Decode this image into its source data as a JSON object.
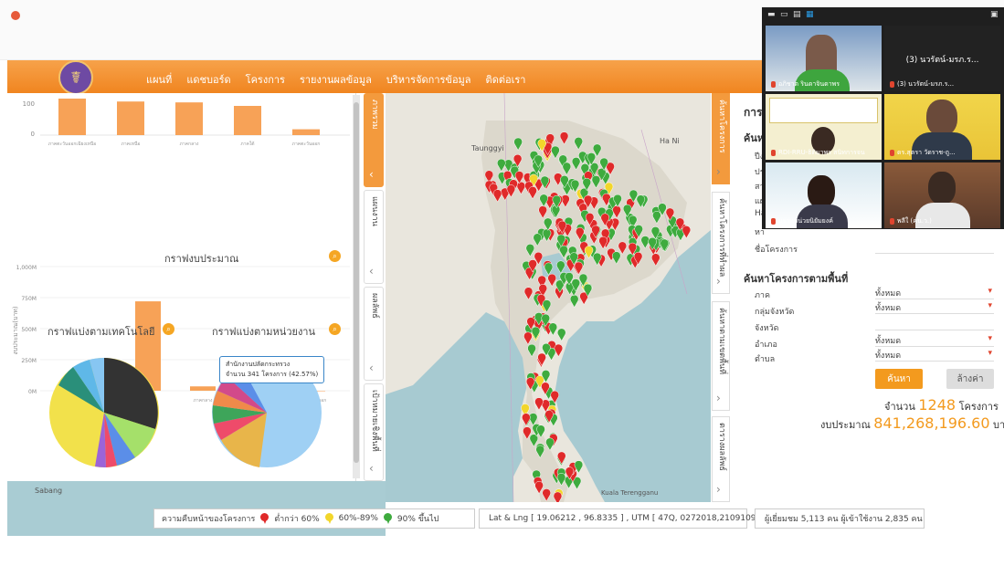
{
  "header": {
    "logo_glyph": "☤",
    "nav": [
      "แผนที่",
      "แดชบอร์ด",
      "โครงการ",
      "รายงานผลข้อมูล",
      "บริหารจัดการข้อมูล",
      "ติดต่อเรา"
    ]
  },
  "left_charts": {
    "top_bar": {
      "type": "bar",
      "yticks": [
        "100",
        "0"
      ],
      "categories": [
        "ภาคตะวันออกเฉียงเหนือ",
        "ภาคเหนือ",
        "ภาคกลาง",
        "ภาคใต้",
        "ภาคตะวันออก"
      ],
      "values": [
        125,
        115,
        112,
        100,
        20
      ]
    },
    "budget_chart": {
      "title": "กราฟงบประมาณ",
      "ylabel": "งบประมาณ(บาท)",
      "yticks": [
        "1,000M",
        "750M",
        "500M",
        "250M",
        "0M"
      ],
      "categories": [
        "ภาคตะวันออกเฉียงเหนือ",
        "ภาคเหนือ",
        "ภาคกลาง",
        "ภาคใต้",
        "ภาคตะวันออก"
      ]
    },
    "tech_pie_title": "กราฟแบ่งตามเทคโนโลยี",
    "unit_pie_title": "กราฟแบ่งตามหน่วยงาน",
    "tooltip": {
      "line1": "สำนักงานปลัดกระทรวง",
      "line2": "จำนวน 341 โครงการ (42.57%)"
    }
  },
  "chart_data": [
    {
      "type": "bar",
      "title": "กราฟงบประมาณ",
      "xlabel": "",
      "ylabel": "งบประมาณ(บาท)",
      "categories": [
        "ภาคตะวันออกเฉียงเหนือ",
        "ภาคเหนือ",
        "ภาคกลาง",
        "ภาคใต้",
        "ภาคตะวันออก"
      ],
      "values": [
        20,
        720,
        35,
        10,
        0
      ],
      "ylim": [
        0,
        1000
      ],
      "unit": "M"
    }
  ],
  "side_tabs": [
    "ภาพรวม",
    "แผนงาน",
    "ผลลัพธ์",
    "เป้าหมายเชิงพื้นที่"
  ],
  "right_tabs": [
    "ค้นหาโครงการ",
    "ค้นหาโครงการที่ทำผล",
    "ค้นหาตามเขตพื้นที่",
    "ตารางผลลัพธ์"
  ],
  "search": {
    "title": "การ",
    "subtitle": "ค้นห",
    "row_stubs": [
      "ปีง",
      "ประ",
      "สา",
      "แผ",
      "Ha",
      "หา"
    ],
    "project_name_label": "ชื่อโครงการ",
    "area_title": "ค้นหาโครงการตามพื้นที่",
    "fields": [
      {
        "label": "ภาค",
        "value": "ทั้งหมด"
      },
      {
        "label": "กลุ่มจังหวัด",
        "value": "ทั้งหมด"
      },
      {
        "label": "จังหวัด",
        "value": ""
      },
      {
        "label": "อำเภอ",
        "value": "ทั้งหมด"
      },
      {
        "label": "ตำบล",
        "value": "ทั้งหมด"
      }
    ],
    "search_btn": "ค้นหา",
    "clear_btn": "ล้างค่า",
    "count_prefix": "จำนวน",
    "count_value": "1248",
    "count_suffix": "โครงการ",
    "budget_prefix": "งบประมาณ",
    "budget_value": "841,268,196.60",
    "budget_suffix": "บาท"
  },
  "map": {
    "labels": [
      "Taunggyi",
      "Ha Ni",
      "Kuala Terengganu",
      "Sabang"
    ]
  },
  "legend": {
    "title": "ความคืบหน้าของโครงการ",
    "items": [
      {
        "label": "ต่ำกว่า 60%",
        "color": "#e02a2a"
      },
      {
        "label": "60%-89%",
        "color": "#f2d62b"
      },
      {
        "label": "90% ขึ้นไป",
        "color": "#3eab3e"
      }
    ]
  },
  "coords": "Lat & Lng [ 19.06212 , 96.8335 ] , UTM [ 47Q, 0272018,2109109 ]",
  "visitors": "ผู้เยี่ยมชม 5,113 คน ผู้เข้าใช้งาน 2,835 คน",
  "video_call": {
    "tiles": [
      {
        "name": "อภิชาต รินดาจินดาพร"
      },
      {
        "name": "(3) นวรัตน์-มรภ.ร...",
        "big": "(3) นวรัตน์-มรภ.ร..."
      },
      {
        "name": "RDI-RRU-ธิติมาพร สนิทการจน"
      },
      {
        "name": "ดร.สุตรา วัดราช-ถู..."
      },
      {
        "name": "บราทหน่วยนิยัมยงค์"
      },
      {
        "name": "พลีใ (คน.ว.)"
      }
    ]
  }
}
